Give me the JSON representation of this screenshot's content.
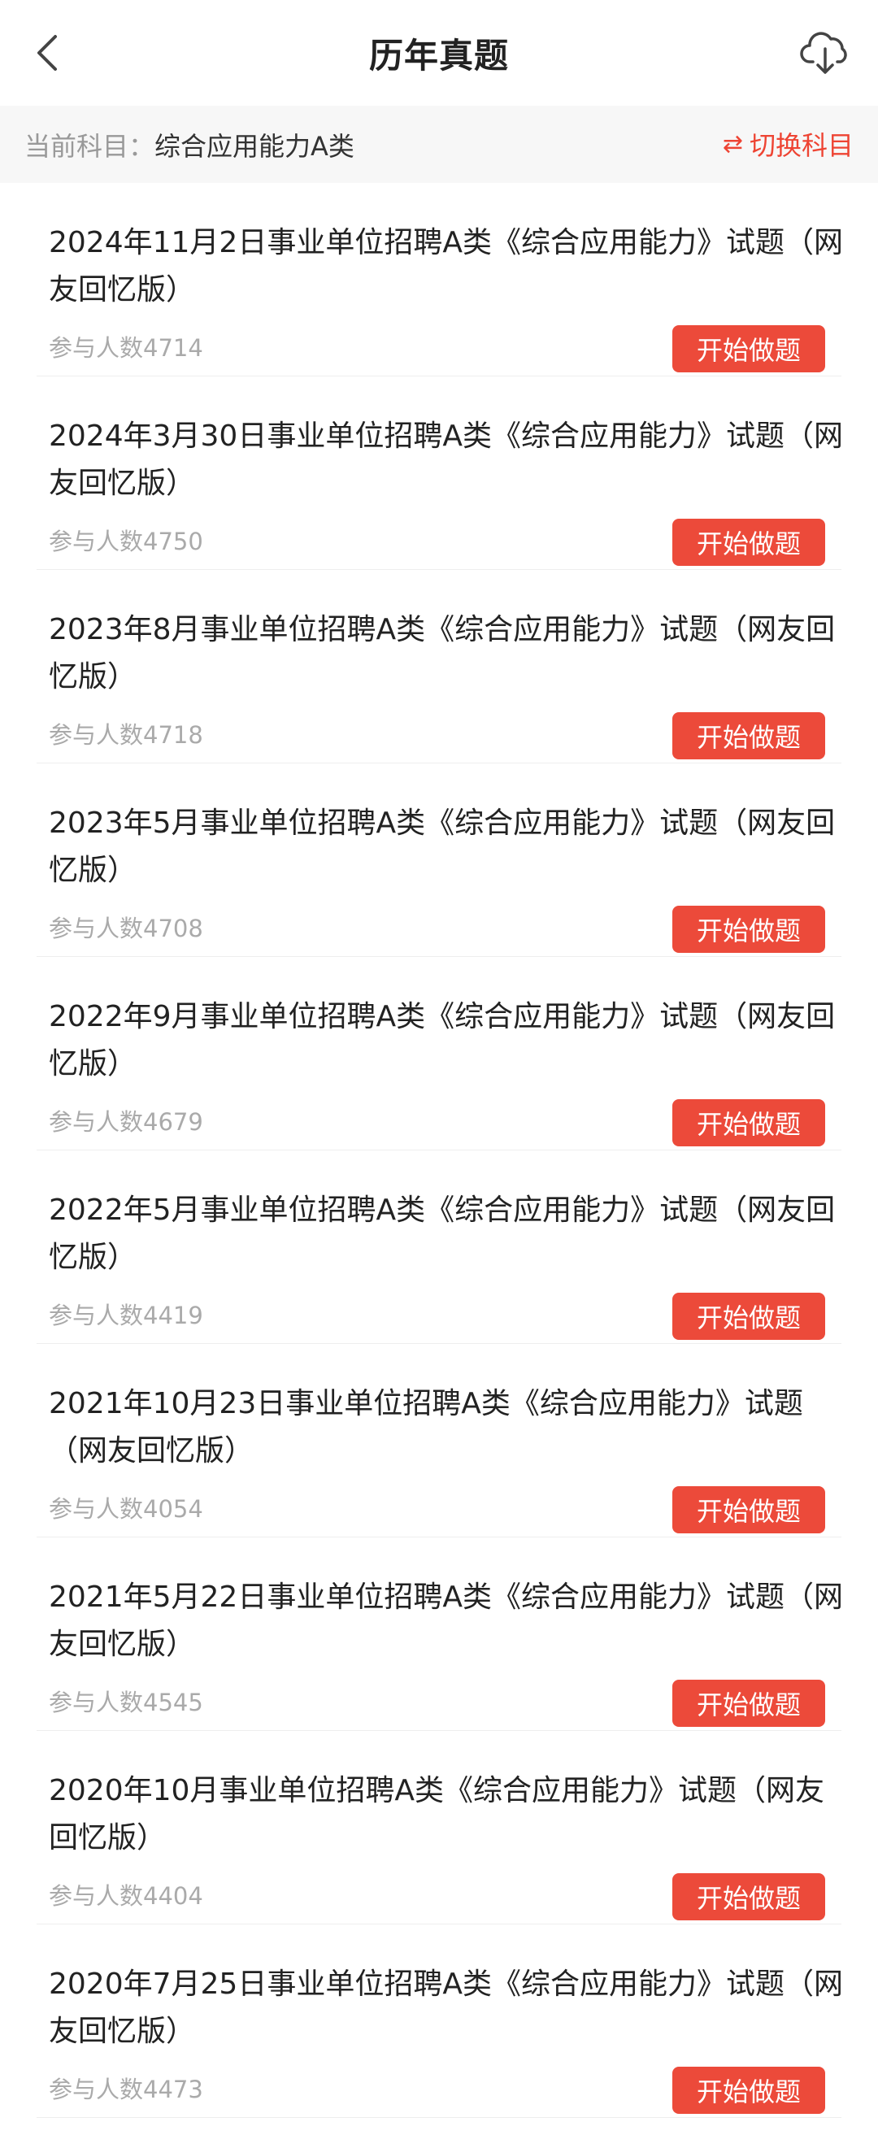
{
  "header": {
    "title": "历年真题",
    "back_icon": "chevron-left-icon",
    "download_icon": "cloud-download-icon"
  },
  "subject": {
    "label": "当前科目：",
    "value": "综合应用能力A类",
    "switch_label": "切换科目",
    "switch_icon": "⇄"
  },
  "colors": {
    "accent": "#ec4a3a",
    "text_primary": "#222222",
    "text_muted": "#aaaaaa"
  },
  "exams": [
    {
      "title": "2024年11月2日事业单位招聘A类《综合应用能力》试题（网友回忆版）",
      "count": "参与人数4714",
      "button": "开始做题"
    },
    {
      "title": "2024年3月30日事业单位招聘A类《综合应用能力》试题（网友回忆版）",
      "count": "参与人数4750",
      "button": "开始做题"
    },
    {
      "title": "2023年8月事业单位招聘A类《综合应用能力》试题（网友回忆版）",
      "count": "参与人数4718",
      "button": "开始做题"
    },
    {
      "title": "2023年5月事业单位招聘A类《综合应用能力》试题（网友回忆版）",
      "count": "参与人数4708",
      "button": "开始做题"
    },
    {
      "title": "2022年9月事业单位招聘A类《综合应用能力》试题（网友回忆版）",
      "count": "参与人数4679",
      "button": "开始做题"
    },
    {
      "title": "2022年5月事业单位招聘A类《综合应用能力》试题（网友回忆版）",
      "count": "参与人数4419",
      "button": "开始做题"
    },
    {
      "title": "2021年10月23日事业单位招聘A类《综合应用能力》试题（网友回忆版）",
      "count": "参与人数4054",
      "button": "开始做题"
    },
    {
      "title": "2021年5月22日事业单位招聘A类《综合应用能力》试题（网友回忆版）",
      "count": "参与人数4545",
      "button": "开始做题"
    },
    {
      "title": "2020年10月事业单位招聘A类《综合应用能力》试题（网友回忆版）",
      "count": "参与人数4404",
      "button": "开始做题"
    },
    {
      "title": "2020年7月25日事业单位招聘A类《综合应用能力》试题（网友回忆版）",
      "count": "参与人数4473",
      "button": "开始做题"
    }
  ]
}
